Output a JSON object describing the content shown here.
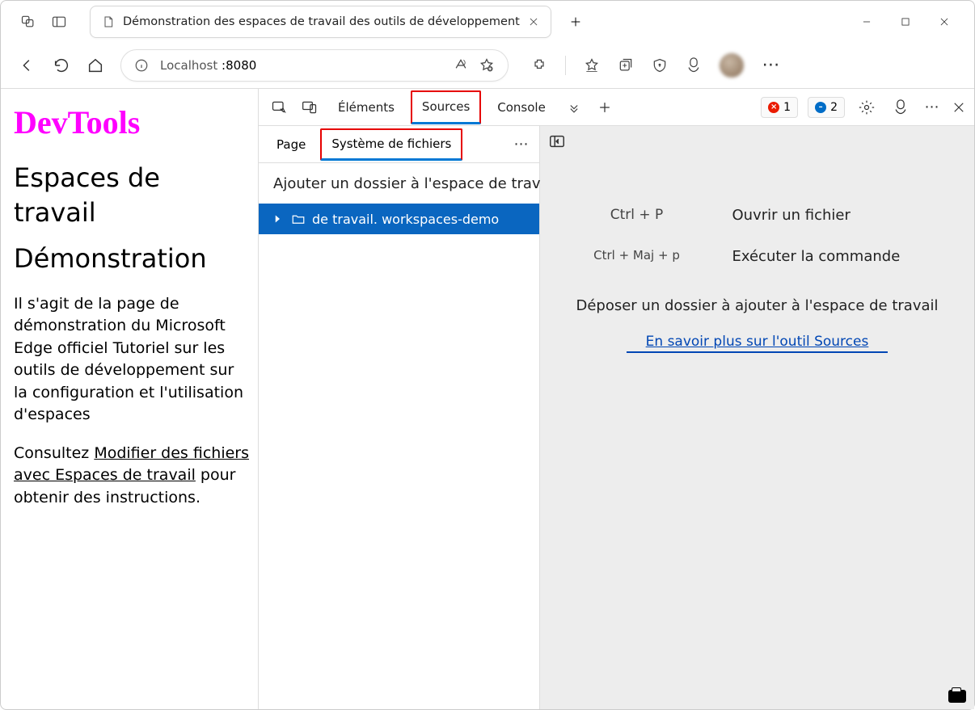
{
  "browser_tab": {
    "title": "Démonstration des espaces de travail des outils de développement"
  },
  "address_bar": {
    "host": "Localhost",
    "port": ":8080"
  },
  "page": {
    "heading": "DevTools",
    "subheading1": "Espaces de travail",
    "subheading2": "Démonstration",
    "paragraph1": "Il s'agit de la page de démonstration du Microsoft Edge officiel Tutoriel sur les outils de développement sur la configuration et l'utilisation d'espaces",
    "para2_pre": "Consultez ",
    "para2_link": "Modifier des fichiers avec Espaces de travail",
    "para2_post": " pour obtenir des instructions."
  },
  "devtools": {
    "tabs": {
      "elements": "Éléments",
      "sources": "Sources",
      "console": "Console"
    },
    "errors_count": "1",
    "info_count": "2",
    "subtabs": {
      "page": "Page",
      "filesystem": "Système de fichiers"
    },
    "add_folder": "Ajouter un dossier à l'espace de travail",
    "folder_label": "de travail. workspaces-demo",
    "shortcuts": {
      "open_key": "Ctrl + P",
      "open_label": "Ouvrir un fichier",
      "cmd_key": "Ctrl + Maj + p",
      "cmd_label": "Exécuter la commande"
    },
    "drop_hint": "Déposer un dossier à ajouter à l'espace de travail",
    "learn_more": "En savoir plus sur l'outil Sources"
  }
}
